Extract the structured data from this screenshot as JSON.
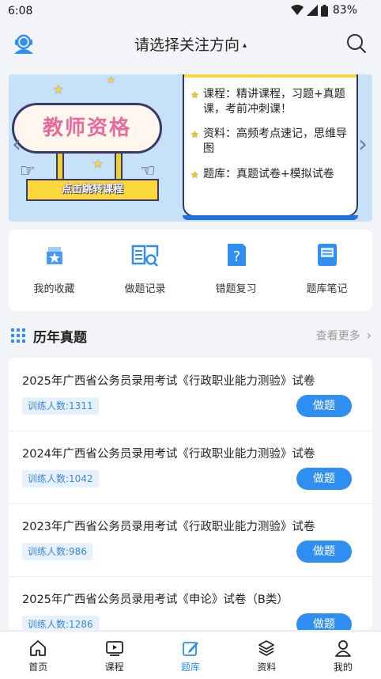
{
  "status_bar": {
    "time": "6:08",
    "battery": "83%",
    "icons": [
      "wifi-icon",
      "cellular-icon",
      "battery-icon"
    ]
  },
  "header": {
    "title": "请选择关注方向",
    "caret": "▴",
    "left_icon": "user-avatar-icon",
    "right_icon": "search-icon"
  },
  "banner": {
    "badge_title": "教师资格",
    "cta": "点击跳转课程",
    "items": [
      {
        "text": "课程：精讲课程，习题+真题课，考前冲刺课！"
      },
      {
        "text": "资料：高频考点速记，思维导图"
      },
      {
        "text": "题库：真题试卷+模拟试卷"
      }
    ],
    "prev_icon": "chevron-left-icon",
    "next_icon": "chevron-right-icon"
  },
  "quick_actions": [
    {
      "label": "我的收藏",
      "icon": "favorites-icon"
    },
    {
      "label": "做题记录",
      "icon": "practice-record-icon"
    },
    {
      "label": "错题复习",
      "icon": "wrong-question-icon"
    },
    {
      "label": "题库笔记",
      "icon": "notes-icon"
    }
  ],
  "section": {
    "title": "历年真题",
    "more": "查看更多",
    "icon": "grid-icon"
  },
  "exams": [
    {
      "title": "2025年广西省公务员录用考试《行政职业能力测验》试卷",
      "trainees": "训练人数:1311",
      "button": "做题"
    },
    {
      "title": "2024年广西省公务员录用考试《行政职业能力测验》试卷",
      "trainees": "训练人数:1042",
      "button": "做题"
    },
    {
      "title": "2023年广西省公务员录用考试《行政职业能力测验》试卷",
      "trainees": "训练人数:986",
      "button": "做题"
    },
    {
      "title": "2025年广西省公务员录用考试《申论》试卷（B类）",
      "trainees": "训练人数:1286",
      "button": "做题"
    }
  ],
  "tabs": [
    {
      "label": "首页",
      "icon": "home-icon",
      "active": false
    },
    {
      "label": "课程",
      "icon": "play-icon",
      "active": false
    },
    {
      "label": "题库",
      "icon": "edit-icon",
      "active": true
    },
    {
      "label": "资料",
      "icon": "layers-icon",
      "active": false
    },
    {
      "label": "我的",
      "icon": "user-icon",
      "active": false
    }
  ],
  "colors": {
    "accent": "#2f8ef2",
    "banner_bg": "#c7e1f8",
    "badge_text": "#e56c9d",
    "page_bg": "#f3f4f7"
  }
}
